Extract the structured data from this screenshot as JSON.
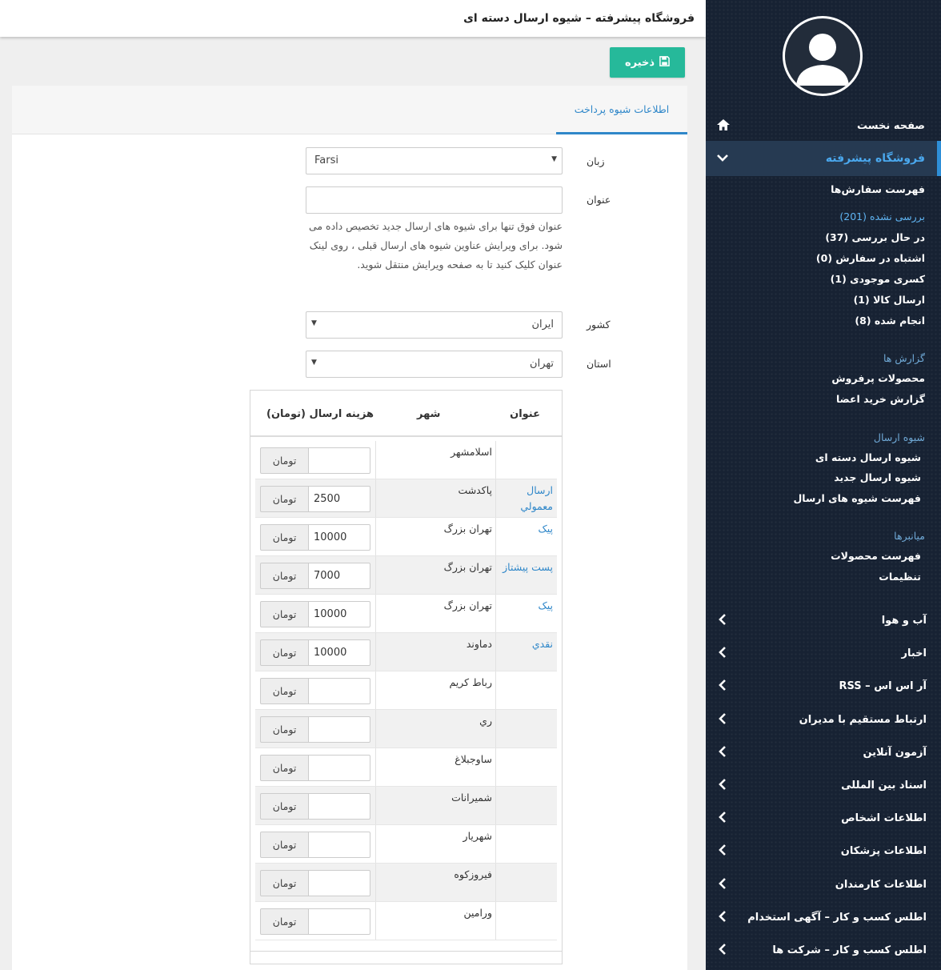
{
  "page": {
    "title": "فروشگاه پیشرفته – شیوه ارسال دسته ای",
    "save_label": "ذخیره"
  },
  "tabs": [
    {
      "label": "اطلاعات شیوه پرداخت",
      "active": true
    }
  ],
  "form": {
    "language": {
      "label": "زبان",
      "value": "Farsi"
    },
    "title": {
      "label": "عنوان",
      "value": "",
      "help": "عنوان فوق تنها برای شیوه های ارسال جدید تخصیص داده می شود. برای ویرایش عناوین شیوه های ارسال قبلی ، روی لینک عنوان کلیک کنید تا به صفحه ویرایش منتقل شوید."
    },
    "country": {
      "label": "کشور",
      "value": "ایران"
    },
    "province": {
      "label": "استان",
      "value": "تهران"
    }
  },
  "table": {
    "headers": {
      "title": "عنوان",
      "city": "شهر",
      "cost": "هزینه ارسال (تومان)"
    },
    "addon": "تومان",
    "rows": [
      {
        "title": "",
        "city": "اسلامشهر",
        "cost": ""
      },
      {
        "title": "ارسال معمولي",
        "city": "پاکدشت",
        "cost": "2500"
      },
      {
        "title": "پیک",
        "city": "تهران بزرگ",
        "cost": "10000"
      },
      {
        "title": "پست پيشتاز",
        "city": "تهران بزرگ",
        "cost": "7000"
      },
      {
        "title": "پیک",
        "city": "تهران بزرگ",
        "cost": "10000"
      },
      {
        "title": "نقدي",
        "city": "دماوند",
        "cost": "10000"
      },
      {
        "title": "",
        "city": "رباط کريم",
        "cost": ""
      },
      {
        "title": "",
        "city": "ري",
        "cost": ""
      },
      {
        "title": "",
        "city": "ساوجبلاغ",
        "cost": ""
      },
      {
        "title": "",
        "city": "شميرانات",
        "cost": ""
      },
      {
        "title": "",
        "city": "شهريار",
        "cost": ""
      },
      {
        "title": "",
        "city": "فيروزکوه",
        "cost": ""
      },
      {
        "title": "",
        "city": "ورامين",
        "cost": ""
      }
    ]
  },
  "sidebar": {
    "home": "صفحه نخست",
    "shop": "فروشگاه پیشرفته",
    "orders_list": "فهرست سفارش‌ها",
    "order_statuses": [
      {
        "label": "بررسی نشده (201)",
        "link": true
      },
      {
        "label": "در حال بررسی (37)",
        "link": false
      },
      {
        "label": "اشتباه در سفارش (0)",
        "link": false
      },
      {
        "label": "کسری موجودی (1)",
        "link": false
      },
      {
        "label": "ارسال کالا (1)",
        "link": false
      },
      {
        "label": "انجام شده (8)",
        "link": false
      }
    ],
    "reports_group": "گزارش ها",
    "reports": [
      "محصولات پرفروش",
      "گزارش خرید اعضا"
    ],
    "shipping_group": "شیوه ارسال",
    "shipping": [
      "شیوه ارسال دسته ای",
      "شیوه ارسال جدید",
      "فهرست شیوه های ارسال"
    ],
    "shortcuts_group": "میانبرها",
    "shortcuts": [
      "فهرست محصولات",
      "تنظیمات"
    ],
    "modules": [
      "آب و هوا",
      "اخبار",
      "آر اس اس – RSS",
      "ارتباط مستقیم با مدیران",
      "آزمون آنلاین",
      "اسناد بین المللی",
      "اطلاعات اشخاص",
      "اطلاعات پزشکان",
      "اطلاعات کارمندان",
      "اطلس کسب و کار – آگهی استخدام",
      "اطلس کسب و کار – شرکت ها"
    ]
  },
  "colors": {
    "sidebar_bg": "#172233",
    "accent_blue": "#2f87c9",
    "save_green": "#26b99a",
    "arrow_red": "#e01010"
  },
  "icons": {
    "save": "floppy-disk-icon",
    "home": "home-icon",
    "collapse": "chevron-down-icon",
    "expand": "chevron-left-icon",
    "avatar": "user-avatar-icon",
    "annotation": "red-arrow-icon"
  }
}
